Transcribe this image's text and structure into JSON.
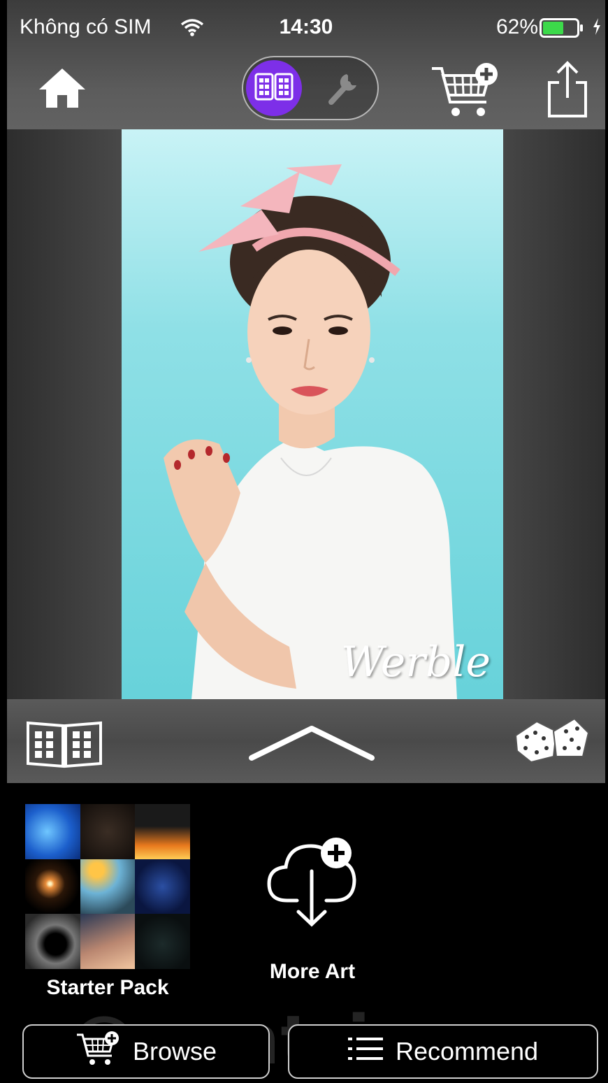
{
  "status_bar": {
    "carrier": "Không có SIM",
    "time": "14:30",
    "battery_percent": "62%",
    "battery_level": 0.62
  },
  "toolbar": {
    "home_icon": "home-icon",
    "mode_toggle": {
      "active": "gallery",
      "options": [
        "gallery-icon",
        "wrench-icon"
      ],
      "active_color": "#7d2fe8"
    },
    "cart_icon": "cart-add-icon",
    "share_icon": "share-icon"
  },
  "photo": {
    "brand": "Werble"
  },
  "lower_toolbar": {
    "left_icon": "book-grid-icon",
    "center_icon": "chevron-up-icon",
    "right_icon": "dice-icon"
  },
  "packs": [
    {
      "label": "Starter Pack",
      "icon": "pack-thumbnail-grid"
    },
    {
      "label": "More Art",
      "icon": "cloud-download-icon"
    }
  ],
  "watermark": "@uantrimang",
  "bottom_buttons": {
    "browse": "Browse",
    "recommend": "Recommend"
  }
}
